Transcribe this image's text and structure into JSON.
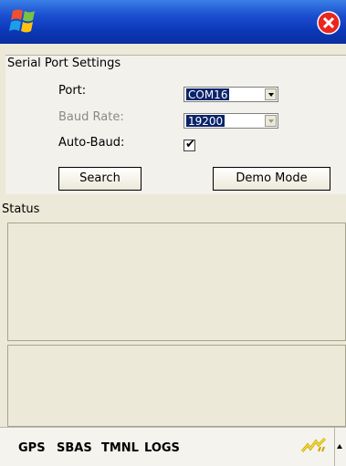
{
  "title_bar": {
    "start_icon": "windows-flag-icon",
    "close_icon": "close-icon",
    "close_color": "#e8271e"
  },
  "serial": {
    "section_title": "Serial Port Settings",
    "port_label": "Port:",
    "port_value": "COM16",
    "baud_label": "Baud Rate:",
    "baud_value": "19200",
    "autobaud_label": "Auto-Baud:",
    "autobaud_checked": true
  },
  "buttons": {
    "search": "Search",
    "demo": "Demo Mode"
  },
  "status": {
    "title": "Status"
  },
  "taskbar": {
    "tabs": [
      "GPS",
      "SBAS",
      "TMNL",
      "LOGS"
    ],
    "tray_icon": "network-signal-icon"
  }
}
